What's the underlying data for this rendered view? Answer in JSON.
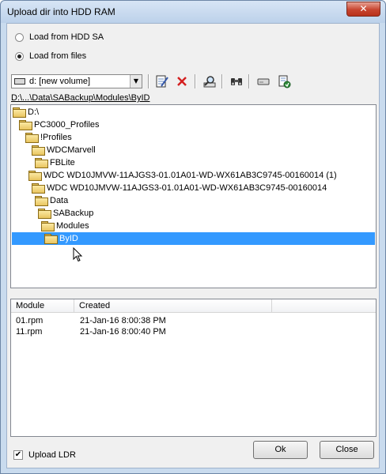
{
  "window": {
    "title": "Upload dir into HDD RAM",
    "close_glyph": "✕"
  },
  "options": {
    "load_from_hdd": {
      "label": "Load from HDD SA",
      "checked": false
    },
    "load_from_files": {
      "label": "Load from files",
      "checked": true
    }
  },
  "toolbar": {
    "drive_select": "d: [new volume]",
    "buttons": [
      "edit-icon",
      "delete-icon",
      "search-icon",
      "binoculars-icon",
      "drive-icon",
      "refresh-icon"
    ]
  },
  "path": "D:\\...\\Data\\SABackup\\Modules\\ByID",
  "tree": [
    "D:\\",
    "PC3000_Profiles",
    "!Profiles",
    "WDCMarvell",
    "FBLite",
    "WDC WD10JMVW-11AJGS3-01.01A01-WD-WX61AB3C9745-00160014 (1)",
    "WDC WD10JMVW-11AJGS3-01.01A01-WD-WX61AB3C9745-00160014",
    "Data",
    "SABackup",
    "Modules",
    "ByID"
  ],
  "selected_tree_item": "ByID",
  "list": {
    "columns": [
      "Module",
      "Created"
    ],
    "rows": [
      {
        "module": "01.rpm",
        "created": "21-Jan-16 8:00:38 PM"
      },
      {
        "module": "11.rpm",
        "created": "21-Jan-16 8:00:40 PM"
      }
    ]
  },
  "upload_ldr": {
    "label": "Upload LDR",
    "checked": true
  },
  "buttons": {
    "ok": "Ok",
    "close": "Close"
  },
  "colors": {
    "selection": "#3399ff",
    "delete": "#d42020"
  }
}
